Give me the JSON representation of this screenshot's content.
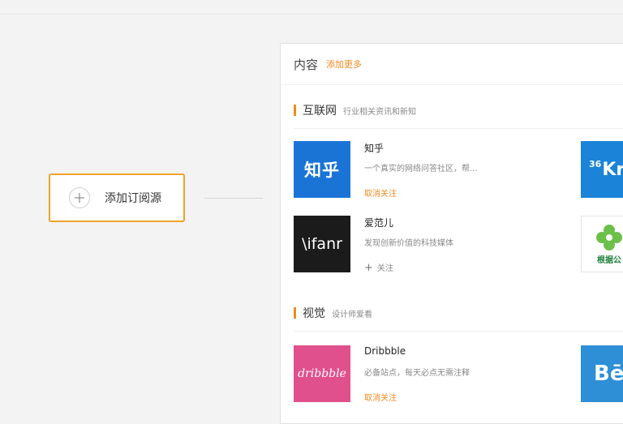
{
  "add_source": {
    "label": "添加订阅源"
  },
  "panel": {
    "title": "内容",
    "add_more": "添加更多"
  },
  "sections": [
    {
      "name": "互联网",
      "desc": "行业相关资讯和新知",
      "items": [
        {
          "thumb_text": "知乎",
          "title": "知乎",
          "desc": "一个真实的网络问答社区，帮...",
          "action": "取消关注"
        },
        {
          "thumb_text": "\\ifanr",
          "title": "爱范儿",
          "desc": "发现创新价值的科技媒体",
          "action": "关注"
        }
      ],
      "side_items": [
        {
          "thumb_text": "Kr",
          "thumb_sup": "36"
        },
        {
          "thumb_text": "根据公"
        }
      ]
    },
    {
      "name": "视觉",
      "desc": "设计师爱看",
      "items": [
        {
          "thumb_text": "dribbble",
          "title": "Dribbble",
          "desc": "必备站点，每天必点无需注释",
          "action": "取消关注"
        }
      ],
      "side_items": [
        {
          "thumb_text": "Bē"
        }
      ]
    }
  ],
  "colors": {
    "accent": "#f08a1f",
    "border_highlight": "#f0a22c",
    "zhihu_blue": "#1a74d6",
    "dribbble_pink": "#e0508c"
  }
}
